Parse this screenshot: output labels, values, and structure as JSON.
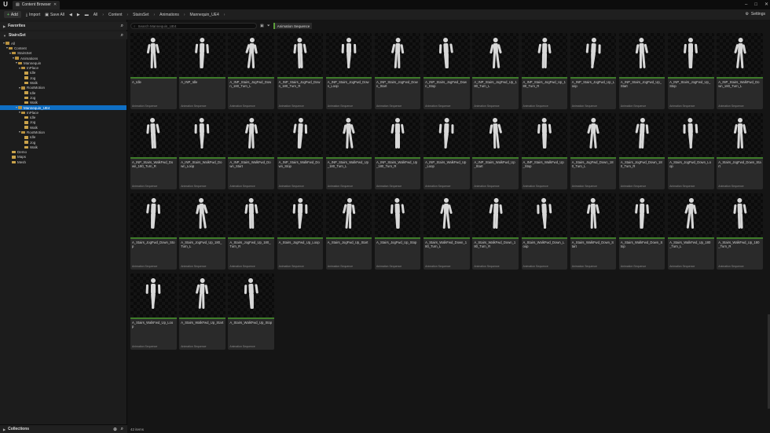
{
  "window": {
    "tab_title": "Content Browser",
    "controls": [
      "–",
      "□",
      "✕"
    ]
  },
  "toolbar": {
    "add_label": "Add",
    "import_label": "Import",
    "save_all_label": "Save All",
    "breadcrumbs": [
      "All",
      "Content",
      "StairsSet",
      "Animations",
      "Mannequin_UE4"
    ],
    "settings_label": "Settings"
  },
  "sidebar": {
    "favorites_label": "Favorites",
    "root_label": "StairsSet",
    "tree": [
      {
        "label": "All",
        "depth": 0,
        "open": true
      },
      {
        "label": "Content",
        "depth": 1,
        "open": true
      },
      {
        "label": "StairsSet",
        "depth": 2,
        "open": true
      },
      {
        "label": "Animations",
        "depth": 3,
        "open": true
      },
      {
        "label": "Mannequin",
        "depth": 4,
        "open": true
      },
      {
        "label": "InPlace",
        "depth": 5,
        "open": true
      },
      {
        "label": "Idle",
        "depth": 6,
        "open": false
      },
      {
        "label": "Jog",
        "depth": 6,
        "open": false
      },
      {
        "label": "Walk",
        "depth": 6,
        "open": false
      },
      {
        "label": "RootMotion",
        "depth": 5,
        "open": true
      },
      {
        "label": "Idle",
        "depth": 6,
        "open": false
      },
      {
        "label": "Jog",
        "depth": 6,
        "open": false
      },
      {
        "label": "Walk",
        "depth": 6,
        "open": false
      },
      {
        "label": "Mannequin_UE4",
        "depth": 4,
        "open": true,
        "selected": true
      },
      {
        "label": "InPlace",
        "depth": 5,
        "open": true
      },
      {
        "label": "Idle",
        "depth": 6,
        "open": false
      },
      {
        "label": "Jog",
        "depth": 6,
        "open": false
      },
      {
        "label": "Walk",
        "depth": 6,
        "open": false
      },
      {
        "label": "RootMotion",
        "depth": 5,
        "open": true
      },
      {
        "label": "Idle",
        "depth": 6,
        "open": false
      },
      {
        "label": "Jog",
        "depth": 6,
        "open": false
      },
      {
        "label": "Walk",
        "depth": 6,
        "open": false
      },
      {
        "label": "Demo",
        "depth": 2,
        "open": false
      },
      {
        "label": "Maps",
        "depth": 2,
        "open": false
      },
      {
        "label": "Mesh",
        "depth": 2,
        "open": false
      }
    ],
    "collections_label": "Collections"
  },
  "main": {
    "search_placeholder": "Search Mannequin_UE4",
    "filter_chip": "Animation Sequence",
    "asset_type": "Animation Sequence",
    "status": "42 items",
    "assets": [
      "A_Idle",
      "A_INP_Idle",
      "A_INP_Stairs_JogFwd_Down_180_Turn_L",
      "A_INP_Stairs_JogFwd_Down_180_Turn_R",
      "A_INP_Stairs_JogFwd_Down_Loop",
      "A_INP_Stairs_JogFwd_Down_Start",
      "A_INP_Stairs_JogFwd_Down_Stop",
      "A_INP_Stairs_JogFwd_Up_180_Turn_L",
      "A_INP_Stairs_JogFwd_Up_180_Turn_R",
      "A_INP_Stairs_JogFwd_Up_Loop",
      "A_INP_Stairs_JogFwd_Up_Start",
      "A_INP_Stairs_JogFwd_Up_Stop",
      "A_INP_Stairs_WalkFwd_Down_180_Turn_L",
      "A_INP_Stairs_WalkFwd_Down_180_Turn_R",
      "A_INP_Stairs_WalkFwd_Down_Loop",
      "A_INP_Stairs_WalkFwd_Down_Start",
      "A_INP_Stairs_WalkFwd_Down_Stop",
      "A_INP_Stairs_WalkFwd_Up_180_Turn_L",
      "A_INP_Stairs_WalkFwd_Up_180_Turn_R",
      "A_INP_Stairs_WalkFwd_Up_Loop",
      "A_INP_Stairs_WalkFwd_Up_Start",
      "A_INP_Stairs_WalkFwd_Up_Stop",
      "A_Stairs_JogFwd_Down_180_Turn_L",
      "A_Stairs_JogFwd_Down_180_Turn_R",
      "A_Stairs_JogFwd_Down_Loop",
      "A_Stairs_JogFwd_Down_Start",
      "A_Stairs_JogFwd_Down_Stop",
      "A_Stairs_JogFwd_Up_180_Turn_L",
      "A_Stairs_JogFwd_Up_180_Turn_R",
      "A_Stairs_JogFwd_Up_Loop",
      "A_Stairs_JogFwd_Up_Start",
      "A_Stairs_JogFwd_Up_Stop",
      "A_Stairs_WalkFwd_Down_180_Turn_L",
      "A_Stairs_WalkFwd_Down_180_Turn_R",
      "A_Stairs_WalkFwd_Down_Loop",
      "A_Stairs_WalkFwd_Down_Start",
      "A_Stairs_WalkFwd_Down_Stop",
      "A_Stairs_WalkFwd_Up_180_Turn_L",
      "A_Stairs_WalkFwd_Up_180_Turn_R",
      "A_Stairs_WalkFwd_Up_Loop",
      "A_Stairs_WalkFwd_Up_Start",
      "A_Stairs_WalkFwd_Up_Stop"
    ]
  },
  "colors": {
    "selection": "#0f6fc4",
    "asset_type_stripe": "#3e7b2a",
    "folder": "#c9a24a"
  }
}
